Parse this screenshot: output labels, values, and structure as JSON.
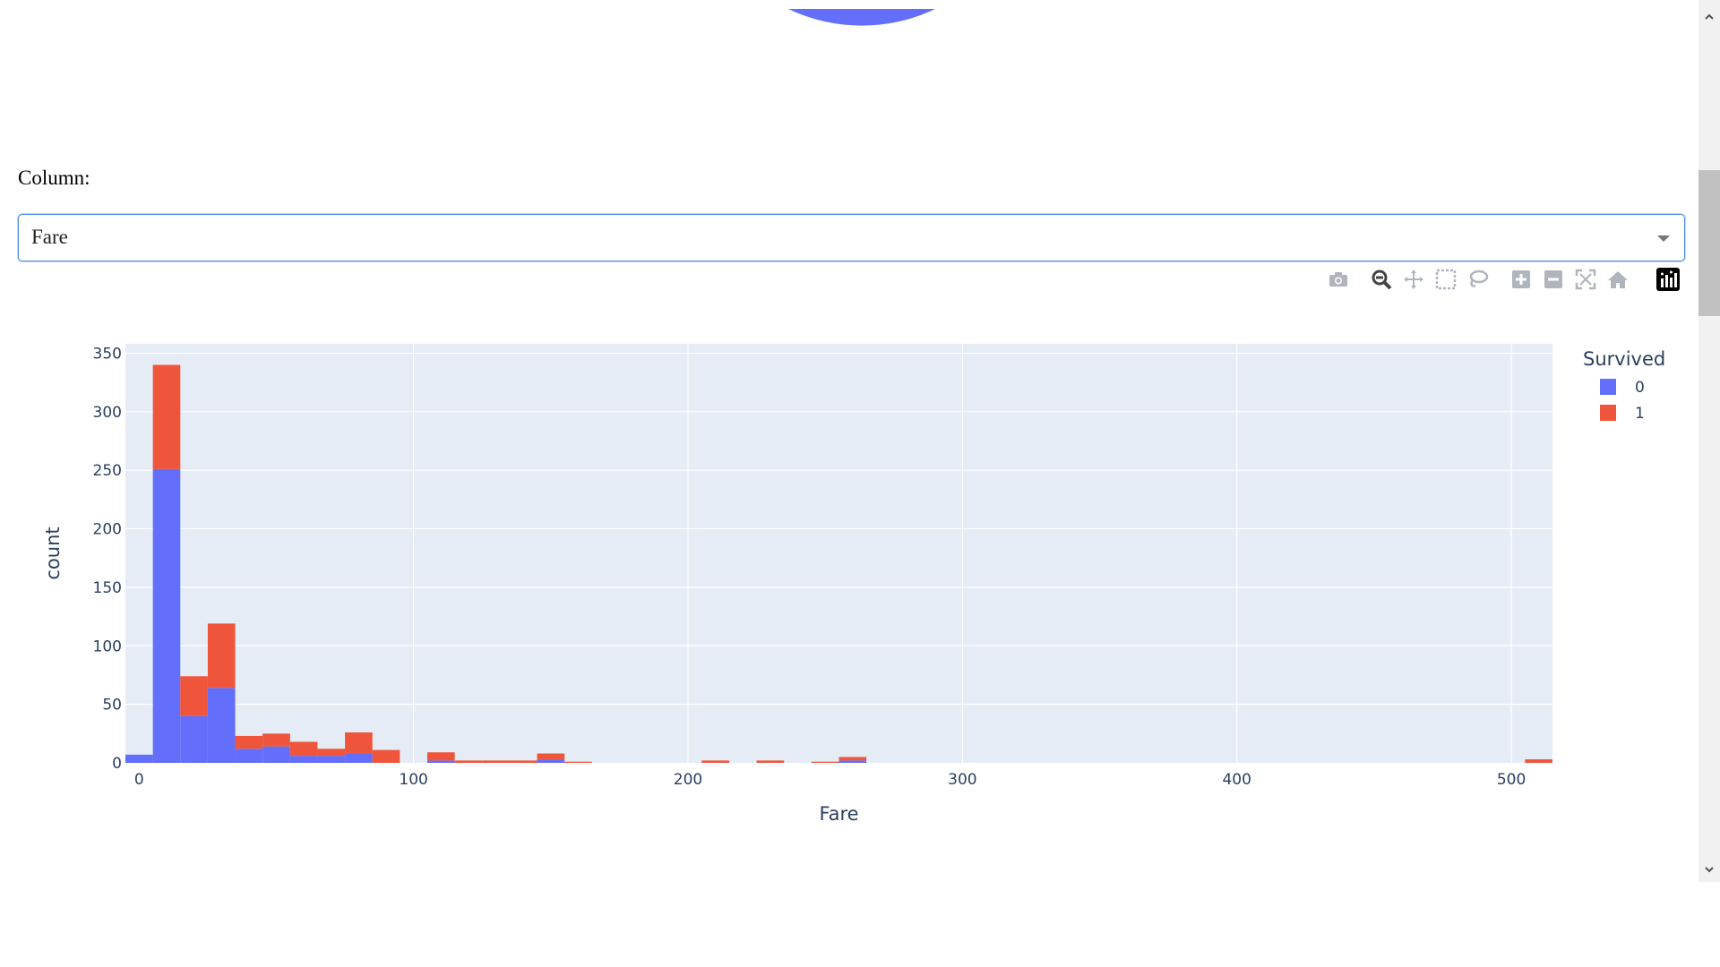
{
  "column_label": "Column:",
  "column_select": {
    "value": "Fare"
  },
  "modebar": {
    "buttons": [
      "camera-icon",
      "zoom-icon",
      "pan-icon",
      "box-select-icon",
      "lasso-icon",
      "zoom-in-icon",
      "zoom-out-icon",
      "autoscale-icon",
      "reset-axes-icon",
      "plotly-logo-icon"
    ]
  },
  "colors": {
    "survived_0": "#636efa",
    "survived_1": "#ef553b",
    "plot_bg": "#e5ecf6",
    "text": "#2a3f5f"
  },
  "chart_data": {
    "type": "bar",
    "barmode": "stack",
    "xlabel": "Fare",
    "ylabel": "count",
    "xlim": [
      -5,
      515
    ],
    "ylim": [
      0,
      358
    ],
    "xticks": [
      "0",
      "100",
      "200",
      "300",
      "400",
      "500"
    ],
    "yticks": [
      "0",
      "50",
      "100",
      "150",
      "200",
      "250",
      "300",
      "350"
    ],
    "bin_width": 10,
    "bin_starts": [
      -5,
      5,
      15,
      25,
      35,
      45,
      55,
      65,
      75,
      85,
      95,
      105,
      115,
      125,
      135,
      145,
      155,
      165,
      175,
      185,
      195,
      205,
      215,
      225,
      235,
      245,
      255,
      265,
      275,
      285,
      295,
      305,
      315,
      325,
      335,
      345,
      355,
      365,
      375,
      385,
      395,
      405,
      415,
      425,
      435,
      445,
      455,
      465,
      475,
      485,
      495,
      505
    ],
    "legend_title": "Survived",
    "legend_position": "right",
    "grid": true,
    "series": [
      {
        "name": "0",
        "color": "#636efa",
        "values": [
          7,
          251,
          40,
          64,
          12,
          14,
          6,
          6,
          8,
          0,
          0,
          2,
          0,
          0,
          0,
          3,
          0,
          0,
          0,
          0,
          0,
          0,
          0,
          0,
          0,
          0,
          2,
          0,
          0,
          0,
          0,
          0,
          0,
          0,
          0,
          0,
          0,
          0,
          0,
          0,
          0,
          0,
          0,
          0,
          0,
          0,
          0,
          0,
          0,
          0,
          0,
          0
        ]
      },
      {
        "name": "1",
        "color": "#ef553b",
        "values": [
          0,
          89,
          34,
          55,
          11,
          11,
          12,
          6,
          18,
          11,
          0,
          7,
          2,
          2,
          2,
          5,
          1,
          0,
          0,
          0,
          0,
          2,
          0,
          2,
          0,
          1,
          3,
          0,
          0,
          0,
          0,
          0,
          0,
          0,
          0,
          0,
          0,
          0,
          0,
          0,
          0,
          0,
          0,
          0,
          0,
          0,
          0,
          0,
          0,
          0,
          0,
          3
        ]
      }
    ]
  }
}
